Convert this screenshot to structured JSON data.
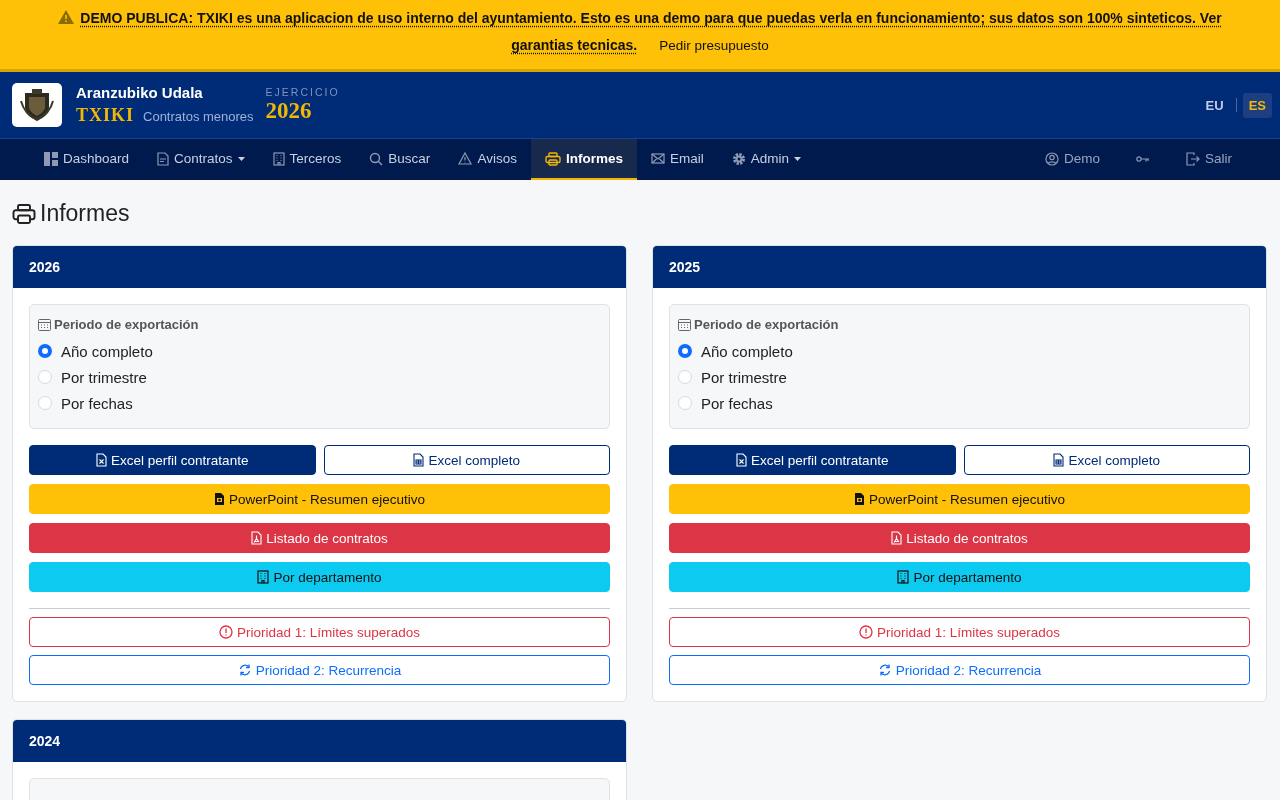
{
  "banner": {
    "text": "DEMO PUBLICA: TXIKI es una aplicacion de uso interno del ayuntamiento. Esto es una demo para que puedas verla en funcionamiento; sus datos son 100% sinteticos. Ver garantias tecnicas.",
    "link": "Pedir presupuesto"
  },
  "header": {
    "org": "Aranzubiko Udala",
    "app": "TXIKI",
    "subtitle": "Contratos menores",
    "year_label": "EJERCICIO",
    "year": "2026",
    "languages": [
      {
        "code": "EU",
        "selected": false
      },
      {
        "code": "ES",
        "selected": true
      }
    ]
  },
  "nav": {
    "items": [
      {
        "label": "Dashboard",
        "dropdown": false,
        "selected": false
      },
      {
        "label": "Contratos",
        "dropdown": true,
        "selected": false
      },
      {
        "label": "Terceros",
        "dropdown": false,
        "selected": false
      },
      {
        "label": "Buscar",
        "dropdown": false,
        "selected": false
      },
      {
        "label": "Avisos",
        "dropdown": false,
        "selected": false
      },
      {
        "label": "Informes",
        "dropdown": false,
        "selected": true
      },
      {
        "label": "Email",
        "dropdown": false,
        "selected": false
      },
      {
        "label": "Admin",
        "dropdown": true,
        "selected": false
      }
    ],
    "right": [
      {
        "kind": "text",
        "label": "Demo"
      },
      {
        "kind": "icon"
      },
      {
        "kind": "text",
        "label": "Salir"
      }
    ]
  },
  "page_title": "Informes",
  "cards": [
    {
      "year": "2026",
      "period": {
        "label": "Periodo de exportación",
        "options": [
          {
            "label": "Año completo",
            "selected": true
          },
          {
            "label": "Por trimestre",
            "selected": false
          },
          {
            "label": "Por fechas",
            "selected": false
          }
        ]
      },
      "buttons": [
        {
          "kind": "primary",
          "label": "Excel perfil contratante"
        },
        {
          "kind": "outline-primary",
          "label": "Excel completo"
        },
        {
          "kind": "warning",
          "label": "PowerPoint - Resumen ejecutivo"
        },
        {
          "kind": "danger",
          "label": "Listado de contratos"
        },
        {
          "kind": "info",
          "label": "Por departamento"
        }
      ],
      "priority_buttons": [
        {
          "kind": "outline-danger",
          "label": "Prioridad 1: Límites superados"
        },
        {
          "kind": "outline-info",
          "label": "Prioridad 2: Recurrencia"
        }
      ]
    },
    {
      "year": "2025",
      "period": {
        "label": "Periodo de exportación",
        "options": [
          {
            "label": "Año completo",
            "selected": true
          },
          {
            "label": "Por trimestre",
            "selected": false
          },
          {
            "label": "Por fechas",
            "selected": false
          }
        ]
      },
      "buttons": [
        {
          "kind": "primary",
          "label": "Excel perfil contratante"
        },
        {
          "kind": "outline-primary",
          "label": "Excel completo"
        },
        {
          "kind": "warning",
          "label": "PowerPoint - Resumen ejecutivo"
        },
        {
          "kind": "danger",
          "label": "Listado de contratos"
        },
        {
          "kind": "info",
          "label": "Por departamento"
        }
      ],
      "priority_buttons": [
        {
          "kind": "outline-danger",
          "label": "Prioridad 1: Límites superados"
        },
        {
          "kind": "outline-info",
          "label": "Prioridad 2: Recurrencia"
        }
      ]
    },
    {
      "year": "2024"
    }
  ]
}
